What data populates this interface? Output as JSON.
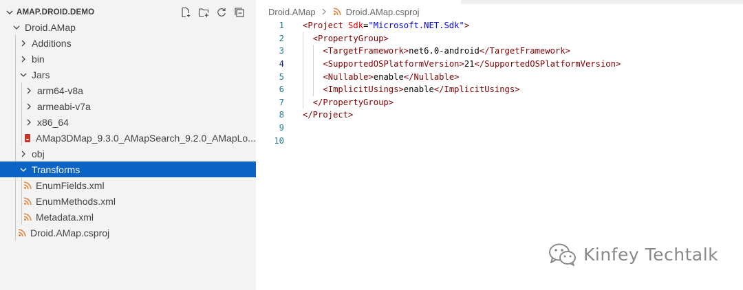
{
  "explorer": {
    "section_title": "AMAP.DROID.DEMO",
    "actions": [
      {
        "name": "new-file",
        "icon": "new-file-icon"
      },
      {
        "name": "new-folder",
        "icon": "new-folder-icon"
      },
      {
        "name": "refresh",
        "icon": "refresh-icon"
      },
      {
        "name": "collapse-all",
        "icon": "collapse-all-icon"
      }
    ],
    "items": [
      {
        "label": "Droid.AMap",
        "depth": 0,
        "kind": "folder",
        "expanded": true
      },
      {
        "label": "Additions",
        "depth": 1,
        "kind": "folder",
        "expanded": false
      },
      {
        "label": "bin",
        "depth": 1,
        "kind": "folder",
        "expanded": false
      },
      {
        "label": "Jars",
        "depth": 1,
        "kind": "folder",
        "expanded": true
      },
      {
        "label": "arm64-v8a",
        "depth": 2,
        "kind": "folder",
        "expanded": false
      },
      {
        "label": "armeabi-v7a",
        "depth": 2,
        "kind": "folder",
        "expanded": false
      },
      {
        "label": "x86_64",
        "depth": 2,
        "kind": "folder",
        "expanded": false
      },
      {
        "label": "AMap3DMap_9.3.0_AMapSearch_9.2.0_AMapLo...",
        "depth": 2,
        "kind": "jar"
      },
      {
        "label": "obj",
        "depth": 1,
        "kind": "folder",
        "expanded": false
      },
      {
        "label": "Transforms",
        "depth": 1,
        "kind": "folder",
        "expanded": true,
        "selected": true
      },
      {
        "label": "EnumFields.xml",
        "depth": 2,
        "kind": "xml"
      },
      {
        "label": "EnumMethods.xml",
        "depth": 2,
        "kind": "xml"
      },
      {
        "label": "Metadata.xml",
        "depth": 2,
        "kind": "xml"
      },
      {
        "label": "Droid.AMap.csproj",
        "depth": 1,
        "kind": "xml"
      }
    ]
  },
  "breadcrumb": {
    "folder": "Droid.AMap",
    "file": "Droid.AMap.csproj"
  },
  "editor": {
    "current_line": 4,
    "lines": [
      {
        "n": "1",
        "indent": 0,
        "tokens": [
          {
            "t": "tag",
            "v": "<Project "
          },
          {
            "t": "attr",
            "v": "Sdk"
          },
          {
            "t": "txt",
            "v": "="
          },
          {
            "t": "str",
            "v": "\"Microsoft.NET.Sdk\""
          },
          {
            "t": "tag",
            "v": ">"
          }
        ]
      },
      {
        "n": "2",
        "indent": 1,
        "tokens": [
          {
            "t": "tag",
            "v": "<PropertyGroup>"
          }
        ]
      },
      {
        "n": "3",
        "indent": 2,
        "tokens": [
          {
            "t": "tag",
            "v": "<TargetFramework>"
          },
          {
            "t": "txt",
            "v": "net6.0-android"
          },
          {
            "t": "tag",
            "v": "</TargetFramework>"
          }
        ]
      },
      {
        "n": "4",
        "indent": 2,
        "tokens": [
          {
            "t": "tag",
            "v": "<SupportedOSPlatformVersion>"
          },
          {
            "t": "txt",
            "v": "21"
          },
          {
            "t": "tag",
            "v": "</SupportedOSPlatformVersion>"
          }
        ]
      },
      {
        "n": "5",
        "indent": 2,
        "tokens": [
          {
            "t": "tag",
            "v": "<Nullable>"
          },
          {
            "t": "txt",
            "v": "enable"
          },
          {
            "t": "tag",
            "v": "</Nullable>"
          }
        ]
      },
      {
        "n": "6",
        "indent": 2,
        "tokens": [
          {
            "t": "tag",
            "v": "<ImplicitUsings>"
          },
          {
            "t": "txt",
            "v": "enable"
          },
          {
            "t": "tag",
            "v": "</ImplicitUsings>"
          }
        ]
      },
      {
        "n": "7",
        "indent": 1,
        "tokens": [
          {
            "t": "tag",
            "v": "</PropertyGroup>"
          }
        ]
      },
      {
        "n": "8",
        "indent": 0,
        "tokens": [
          {
            "t": "tag",
            "v": "</Project>"
          }
        ]
      },
      {
        "n": "9",
        "indent": 0,
        "tokens": []
      },
      {
        "n": "10",
        "indent": 0,
        "tokens": []
      }
    ]
  },
  "watermark": {
    "text": "Kinfey Techtalk"
  },
  "colors": {
    "selection": "#0b63c4",
    "tag": "#800000",
    "attribute": "#e50000",
    "string": "#0000ff",
    "line_number": "#237893",
    "rss_orange": "#e8843c",
    "jar_red": "#c5352c"
  }
}
